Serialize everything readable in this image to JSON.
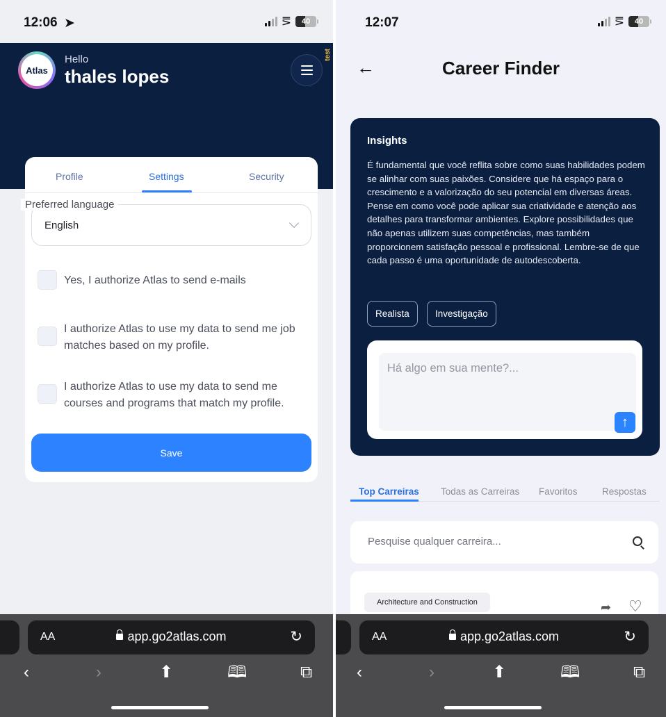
{
  "left": {
    "status": {
      "time": "12:06",
      "battery": "40"
    },
    "header": {
      "logo_text": "Atlas",
      "greeting": "Hello",
      "username": "thales lopes",
      "env_tag": "test"
    },
    "tabs": [
      {
        "label": "Profile"
      },
      {
        "label": "Settings"
      },
      {
        "label": "Security"
      }
    ],
    "language": {
      "legend": "Preferred language",
      "value": "English"
    },
    "consents": [
      {
        "label": "Yes, I authorize Atlas to send e-mails",
        "checked": false
      },
      {
        "label": "I authorize Atlas to use my data to send me job matches based on my profile.",
        "checked": false
      },
      {
        "label": "I authorize Atlas to use my data to send me courses and programs that match my profile.",
        "checked": false
      }
    ],
    "save_label": "Save",
    "browser": {
      "aa": "AA",
      "url": "app.go2atlas.com"
    }
  },
  "right": {
    "status": {
      "time": "12:07",
      "battery": "40"
    },
    "title": "Career Finder",
    "insights": {
      "title": "Insights",
      "text": "É fundamental que você reflita sobre como suas habilidades podem se alinhar com suas paixões. Considere que há espaço para o crescimento e a valorização do seu potencial em diversas áreas. Pense em como você pode aplicar sua criatividade e atenção aos detalhes para transformar ambientes. Explore possibilidades que não apenas utilizem suas competências, mas também proporcionem satisfação pessoal e profissional. Lembre-se de que cada passo é uma oportunidade de autodescoberta.",
      "chips": [
        "Realista",
        "Investigação"
      ],
      "chat_placeholder": "Há algo em sua mente?..."
    },
    "career_tabs": [
      {
        "label": "Top Carreiras"
      },
      {
        "label": "Todas as Carreiras"
      },
      {
        "label": "Favoritos"
      },
      {
        "label": "Respostas"
      }
    ],
    "search_placeholder": "Pesquise qualquer carreira...",
    "career_card": {
      "tag": "Architecture and Construction"
    },
    "browser": {
      "aa": "AA",
      "url": "app.go2atlas.com"
    }
  },
  "colors": {
    "navy": "#0b1f40",
    "accent_blue": "#2d83ff",
    "safari_bar": "#4b4b4d"
  }
}
